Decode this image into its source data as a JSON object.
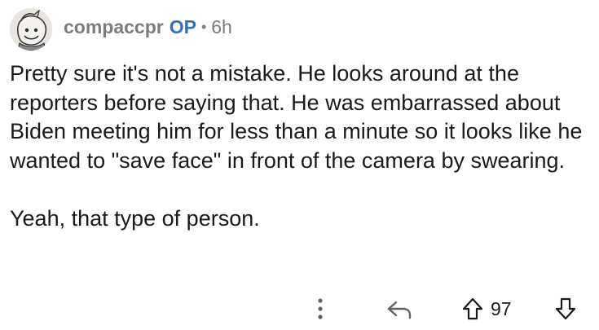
{
  "comment": {
    "username": "compaccpr",
    "op_badge": "OP",
    "separator": "•",
    "age": "6h",
    "avatar_icon": "snoo-avatar-icon",
    "paragraphs": [
      "Pretty sure it's not a mistake. He looks around at the reporters before saying that. He was embarrassed about Biden meeting him for less than a minute so it looks like he wanted to \"save face\" in front of the camera by swearing.",
      "Yeah, that type of person."
    ]
  },
  "actions": {
    "more_icon": "more-vertical-icon",
    "reply_icon": "reply-icon",
    "upvote_icon": "upvote-arrow-icon",
    "score": "97",
    "downvote_icon": "downvote-arrow-icon"
  },
  "colors": {
    "op": "#2f6fbe",
    "meta": "#7c7c7c",
    "text": "#1a1a1b"
  }
}
